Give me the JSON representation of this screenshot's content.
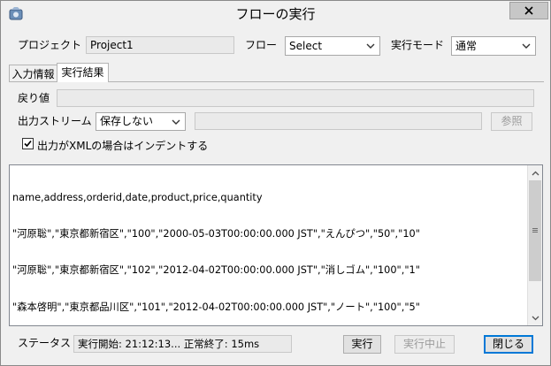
{
  "window": {
    "title": "フローの実行",
    "close_glyph": "×"
  },
  "project": {
    "label": "プロジェクト",
    "value": "Project1"
  },
  "flow": {
    "label": "フロー",
    "selected": "Select"
  },
  "mode": {
    "label": "実行モード",
    "selected": "通常"
  },
  "tabs": [
    {
      "label": "入力情報",
      "active": false
    },
    {
      "label": "実行結果",
      "active": true
    }
  ],
  "result": {
    "return_label": "戻り値",
    "return_value": "",
    "stream_label": "出力ストリーム",
    "stream_selected": "保存しない",
    "stream_path": "",
    "browse_label": "参照",
    "indent_label": "出力がXMLの場合はインデントする",
    "indent_checked": true
  },
  "output_lines": [
    "name,address,orderid,date,product,price,quantity",
    "\"河原聡\",\"東京都新宿区\",\"100\",\"2000-05-03T00:00:00.000 JST\",\"えんぴつ\",\"50\",\"10\"",
    "\"河原聡\",\"東京都新宿区\",\"102\",\"2012-04-02T00:00:00.000 JST\",\"消しゴム\",\"100\",\"1\"",
    "\"森本啓明\",\"東京都品川区\",\"101\",\"2012-04-02T00:00:00.000 JST\",\"ノート\",\"100\",\"5\""
  ],
  "status": {
    "label": "ステータス",
    "value": "実行開始: 21:12:13... 正常終了: 15ms"
  },
  "buttons": {
    "run": "実行",
    "stop": "実行中止",
    "close": "閉じる"
  },
  "colors": {
    "focus_border": "#0078d7",
    "window_bg": "#f0f0f0"
  }
}
